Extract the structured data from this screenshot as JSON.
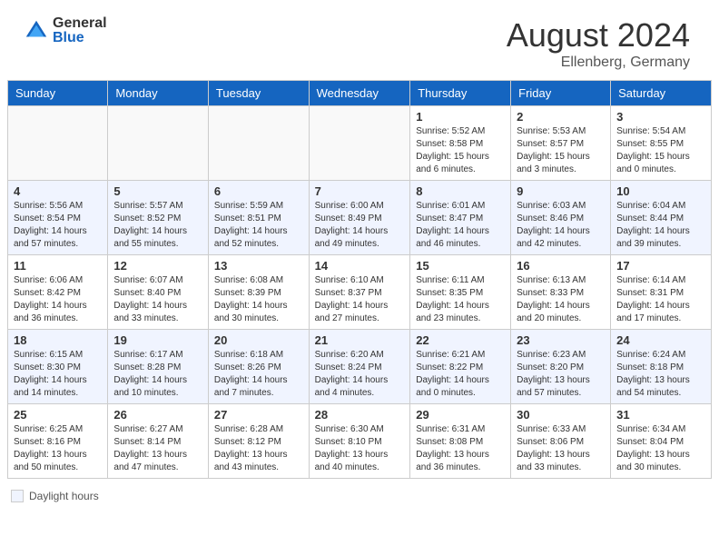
{
  "header": {
    "logo_general": "General",
    "logo_blue": "Blue",
    "month_year": "August 2024",
    "location": "Ellenberg, Germany"
  },
  "calendar": {
    "days_of_week": [
      "Sunday",
      "Monday",
      "Tuesday",
      "Wednesday",
      "Thursday",
      "Friday",
      "Saturday"
    ],
    "weeks": [
      [
        {
          "day": "",
          "info": ""
        },
        {
          "day": "",
          "info": ""
        },
        {
          "day": "",
          "info": ""
        },
        {
          "day": "",
          "info": ""
        },
        {
          "day": "1",
          "info": "Sunrise: 5:52 AM\nSunset: 8:58 PM\nDaylight: 15 hours and 6 minutes."
        },
        {
          "day": "2",
          "info": "Sunrise: 5:53 AM\nSunset: 8:57 PM\nDaylight: 15 hours and 3 minutes."
        },
        {
          "day": "3",
          "info": "Sunrise: 5:54 AM\nSunset: 8:55 PM\nDaylight: 15 hours and 0 minutes."
        }
      ],
      [
        {
          "day": "4",
          "info": "Sunrise: 5:56 AM\nSunset: 8:54 PM\nDaylight: 14 hours and 57 minutes."
        },
        {
          "day": "5",
          "info": "Sunrise: 5:57 AM\nSunset: 8:52 PM\nDaylight: 14 hours and 55 minutes."
        },
        {
          "day": "6",
          "info": "Sunrise: 5:59 AM\nSunset: 8:51 PM\nDaylight: 14 hours and 52 minutes."
        },
        {
          "day": "7",
          "info": "Sunrise: 6:00 AM\nSunset: 8:49 PM\nDaylight: 14 hours and 49 minutes."
        },
        {
          "day": "8",
          "info": "Sunrise: 6:01 AM\nSunset: 8:47 PM\nDaylight: 14 hours and 46 minutes."
        },
        {
          "day": "9",
          "info": "Sunrise: 6:03 AM\nSunset: 8:46 PM\nDaylight: 14 hours and 42 minutes."
        },
        {
          "day": "10",
          "info": "Sunrise: 6:04 AM\nSunset: 8:44 PM\nDaylight: 14 hours and 39 minutes."
        }
      ],
      [
        {
          "day": "11",
          "info": "Sunrise: 6:06 AM\nSunset: 8:42 PM\nDaylight: 14 hours and 36 minutes."
        },
        {
          "day": "12",
          "info": "Sunrise: 6:07 AM\nSunset: 8:40 PM\nDaylight: 14 hours and 33 minutes."
        },
        {
          "day": "13",
          "info": "Sunrise: 6:08 AM\nSunset: 8:39 PM\nDaylight: 14 hours and 30 minutes."
        },
        {
          "day": "14",
          "info": "Sunrise: 6:10 AM\nSunset: 8:37 PM\nDaylight: 14 hours and 27 minutes."
        },
        {
          "day": "15",
          "info": "Sunrise: 6:11 AM\nSunset: 8:35 PM\nDaylight: 14 hours and 23 minutes."
        },
        {
          "day": "16",
          "info": "Sunrise: 6:13 AM\nSunset: 8:33 PM\nDaylight: 14 hours and 20 minutes."
        },
        {
          "day": "17",
          "info": "Sunrise: 6:14 AM\nSunset: 8:31 PM\nDaylight: 14 hours and 17 minutes."
        }
      ],
      [
        {
          "day": "18",
          "info": "Sunrise: 6:15 AM\nSunset: 8:30 PM\nDaylight: 14 hours and 14 minutes."
        },
        {
          "day": "19",
          "info": "Sunrise: 6:17 AM\nSunset: 8:28 PM\nDaylight: 14 hours and 10 minutes."
        },
        {
          "day": "20",
          "info": "Sunrise: 6:18 AM\nSunset: 8:26 PM\nDaylight: 14 hours and 7 minutes."
        },
        {
          "day": "21",
          "info": "Sunrise: 6:20 AM\nSunset: 8:24 PM\nDaylight: 14 hours and 4 minutes."
        },
        {
          "day": "22",
          "info": "Sunrise: 6:21 AM\nSunset: 8:22 PM\nDaylight: 14 hours and 0 minutes."
        },
        {
          "day": "23",
          "info": "Sunrise: 6:23 AM\nSunset: 8:20 PM\nDaylight: 13 hours and 57 minutes."
        },
        {
          "day": "24",
          "info": "Sunrise: 6:24 AM\nSunset: 8:18 PM\nDaylight: 13 hours and 54 minutes."
        }
      ],
      [
        {
          "day": "25",
          "info": "Sunrise: 6:25 AM\nSunset: 8:16 PM\nDaylight: 13 hours and 50 minutes."
        },
        {
          "day": "26",
          "info": "Sunrise: 6:27 AM\nSunset: 8:14 PM\nDaylight: 13 hours and 47 minutes."
        },
        {
          "day": "27",
          "info": "Sunrise: 6:28 AM\nSunset: 8:12 PM\nDaylight: 13 hours and 43 minutes."
        },
        {
          "day": "28",
          "info": "Sunrise: 6:30 AM\nSunset: 8:10 PM\nDaylight: 13 hours and 40 minutes."
        },
        {
          "day": "29",
          "info": "Sunrise: 6:31 AM\nSunset: 8:08 PM\nDaylight: 13 hours and 36 minutes."
        },
        {
          "day": "30",
          "info": "Sunrise: 6:33 AM\nSunset: 8:06 PM\nDaylight: 13 hours and 33 minutes."
        },
        {
          "day": "31",
          "info": "Sunrise: 6:34 AM\nSunset: 8:04 PM\nDaylight: 13 hours and 30 minutes."
        }
      ]
    ]
  },
  "legend": {
    "label": "Daylight hours"
  }
}
